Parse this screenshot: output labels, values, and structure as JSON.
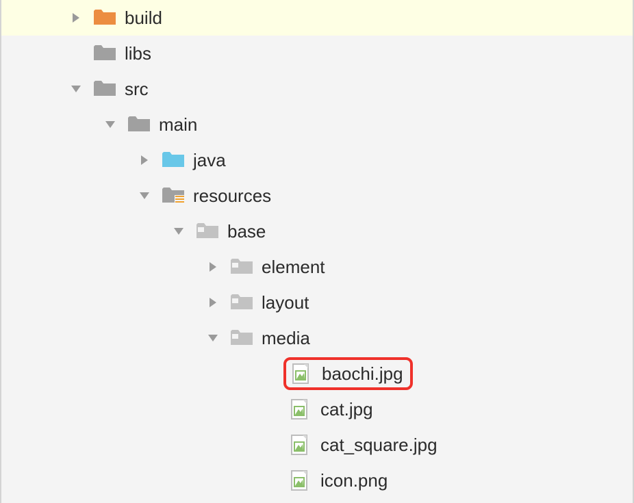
{
  "tree": {
    "items": [
      {
        "indent": 98,
        "chevron": "right",
        "icon": "folder-orange",
        "label": "build",
        "selected": true,
        "highlight": false
      },
      {
        "indent": 98,
        "chevron": "none",
        "icon": "folder-grey",
        "label": "libs",
        "selected": false,
        "highlight": false
      },
      {
        "indent": 98,
        "chevron": "down",
        "icon": "folder-grey",
        "label": "src",
        "selected": false,
        "highlight": false
      },
      {
        "indent": 148,
        "chevron": "down",
        "icon": "folder-grey",
        "label": "main",
        "selected": false,
        "highlight": false
      },
      {
        "indent": 198,
        "chevron": "right",
        "icon": "folder-blue",
        "label": "java",
        "selected": false,
        "highlight": false
      },
      {
        "indent": 198,
        "chevron": "down",
        "icon": "folder-res",
        "label": "resources",
        "selected": false,
        "highlight": false
      },
      {
        "indent": 248,
        "chevron": "down",
        "icon": "folder-light",
        "label": "base",
        "selected": false,
        "highlight": false
      },
      {
        "indent": 298,
        "chevron": "right",
        "icon": "folder-light",
        "label": "element",
        "selected": false,
        "highlight": false
      },
      {
        "indent": 298,
        "chevron": "right",
        "icon": "folder-light",
        "label": "layout",
        "selected": false,
        "highlight": false
      },
      {
        "indent": 298,
        "chevron": "down",
        "icon": "folder-light",
        "label": "media",
        "selected": false,
        "highlight": false
      },
      {
        "indent": 384,
        "chevron": "none",
        "icon": "image-file",
        "label": "baochi.jpg",
        "selected": false,
        "highlight": true
      },
      {
        "indent": 384,
        "chevron": "none",
        "icon": "image-file",
        "label": "cat.jpg",
        "selected": false,
        "highlight": false
      },
      {
        "indent": 384,
        "chevron": "none",
        "icon": "image-file",
        "label": "cat_square.jpg",
        "selected": false,
        "highlight": false
      },
      {
        "indent": 384,
        "chevron": "none",
        "icon": "image-file",
        "label": "icon.png",
        "selected": false,
        "highlight": false
      }
    ]
  }
}
